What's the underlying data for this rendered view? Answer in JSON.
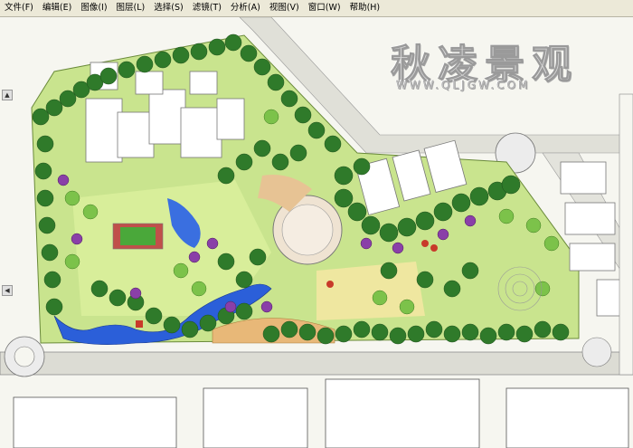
{
  "menu": {
    "items": [
      {
        "label": "文件(F)",
        "name": "menu-file"
      },
      {
        "label": "编辑(E)",
        "name": "menu-edit"
      },
      {
        "label": "图像(I)",
        "name": "menu-image"
      },
      {
        "label": "图层(L)",
        "name": "menu-layer"
      },
      {
        "label": "选择(S)",
        "name": "menu-select"
      },
      {
        "label": "滤镜(T)",
        "name": "menu-filter"
      },
      {
        "label": "分析(A)",
        "name": "menu-analysis"
      },
      {
        "label": "视图(V)",
        "name": "menu-view"
      },
      {
        "label": "窗口(W)",
        "name": "menu-window"
      },
      {
        "label": "帮助(H)",
        "name": "menu-help"
      }
    ]
  },
  "watermark": {
    "title": "秋凌景观",
    "url": "WWW.QLJGW.COM"
  },
  "colors": {
    "tree_dark": "#2f7a2a",
    "tree_light": "#6fbf3c",
    "lawn": "#c8e38a",
    "water": "#2b5fd9",
    "plaza": "#e8c88a",
    "purple_shrub": "#8a3fa8",
    "road": "#d9d9d2",
    "building": "#ffffff"
  }
}
